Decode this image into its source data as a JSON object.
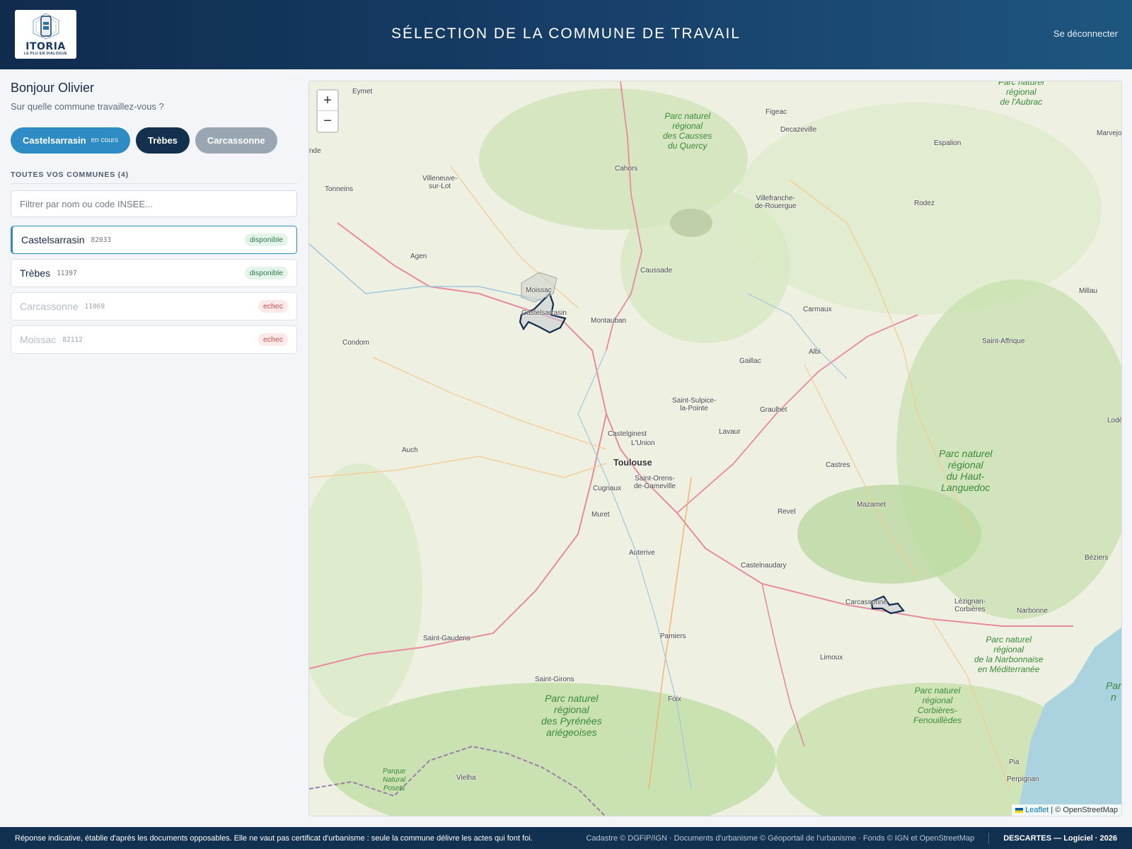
{
  "header": {
    "logo_text": "ITORIA",
    "logo_tagline": "LE PLU EN DIALOGUE",
    "title": "SÉLECTION DE LA COMMUNE DE TRAVAIL",
    "logout_label": "Se déconnecter"
  },
  "sidebar": {
    "greeting": "Bonjour Olivier",
    "question": "Sur quelle commune travaillez-vous ?",
    "pills": [
      {
        "label": "Castelsarrasin",
        "tag": "en cours"
      },
      {
        "label": "Trèbes"
      },
      {
        "label": "Carcassonne"
      }
    ],
    "section_title": "TOUTES VOS COMMUNES (4)",
    "filter_placeholder": "Filtrer par nom ou code INSEE...",
    "communes": [
      {
        "name": "Castelsarrasin",
        "code": "82033",
        "status": "disponible"
      },
      {
        "name": "Trèbes",
        "code": "11397",
        "status": "disponible"
      },
      {
        "name": "Carcassonne",
        "code": "11069",
        "status": "echec"
      },
      {
        "name": "Moissac",
        "code": "82112",
        "status": "echec"
      }
    ]
  },
  "map": {
    "zoom_in": "+",
    "zoom_out": "−",
    "attribution_lib": "Leaflet",
    "attribution_sep": "|",
    "attribution_src": "© OpenStreetMap",
    "places": {
      "eymet": "Eymet",
      "figeac": "Figeac",
      "decazeville": "Decazeville",
      "espalion": "Espalion",
      "marvejols": "Marvejols",
      "nde": "nde",
      "cahors": "Cahors",
      "villeneuve": "Villeneuve-\nsur-Lot",
      "tonneins": "Tonneins",
      "villefranche": "Villefranche-\nde-Rouergue",
      "rodez": "Rodez",
      "agen": "Agen",
      "caussade": "Caussade",
      "moissac": "Moissac",
      "castelsarrasin": "Castelsarrasin",
      "montauban": "Montauban",
      "carmaux": "Carmaux",
      "millau": "Millau",
      "condom": "Condom",
      "albi": "Albi",
      "gaillac": "Gaillac",
      "saint_affrique": "Saint-Affrique",
      "saint_sulpice": "Saint-Sulpice-\nla-Pointe",
      "graulhet": "Graulhet",
      "lavaur": "Lavaur",
      "castelginest": "Castelginest",
      "lunion": "L'Union",
      "lode": "Lodè",
      "auch": "Auch",
      "toulouse": "Toulouse",
      "castres": "Castres",
      "cugnaux": "Cugnaux",
      "saint_orens": "Saint-Orens-\nde-Gameville",
      "mazamet": "Mazamet",
      "muret": "Muret",
      "revel": "Revel",
      "auterive": "Auterive",
      "beziers": "Béziers",
      "castelnaudary": "Castelnaudary",
      "carcassonne": "Carcassonne",
      "lezignan": "Lézignan-\nCorbières",
      "narbonne": "Narbonne",
      "saint_gaudens": "Saint-Gaudens",
      "pamiers": "Pamiers",
      "limoux": "Limoux",
      "saint_girons": "Saint-Girons",
      "foix": "Foix",
      "vielha": "Vielha",
      "perpignan": "Perpignan",
      "pia": "Pia"
    },
    "parks": {
      "aubrac": "Parc naturel\nrégional\nde l'Aubrac",
      "quercy": "Parc naturel\nrégional\ndes Causses\ndu Quercy",
      "haut_languedoc": "Parc naturel\nrégional\ndu Haut-\nLanguedoc",
      "narbonnaise": "Parc naturel\nrégional\nde la Narbonnaise\nen Méditerranée",
      "corbieres": "Parc naturel\nrégional\nCorbières-\nFenouillèdes",
      "pyrenees": "Parc naturel\nrégional\ndes Pyrénées\nariégeoises",
      "pyrenees_parc": "Parque\nNatural\nPosets",
      "par": "Par\nn"
    }
  },
  "footer": {
    "disclaimer": "Réponse indicative, établie d'après les documents opposables. Elle ne vaut pas certificat d'urbanisme : seule la commune délivre les actes qui font foi.",
    "credits": "Cadastre © DGFiP/IGN · Documents d'urbanisme © Géoportail de l'urbanisme · Fonds © IGN et OpenStreetMap",
    "brand": "DESCARTES — Logiciel · 2026"
  }
}
